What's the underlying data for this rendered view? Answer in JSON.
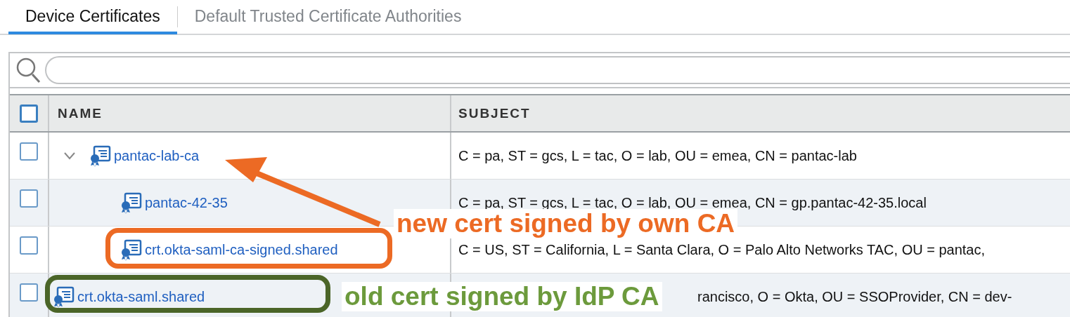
{
  "tabs": [
    {
      "label": "Device Certificates",
      "selected": true
    },
    {
      "label": "Default Trusted Certificate Authorities",
      "selected": false
    }
  ],
  "table": {
    "header_checkbox": {
      "checked": false
    },
    "columns": [
      "NAME",
      "SUBJECT"
    ],
    "rows": [
      {
        "name": "pantac-lab-ca",
        "subject": "C = pa, ST = gcs, L = tac, O = lab, OU = emea, CN = pantac-lab",
        "checked": false,
        "expanded": true,
        "children": [
          {
            "name": "pantac-42-35",
            "subject": "C = pa, ST = gcs, L = tac, O = lab, OU = emea, CN = gp.pantac-42-35.local",
            "checked": false
          },
          {
            "name": "crt.okta-saml-ca-signed.shared",
            "subject": "C = US, ST = California, L = Santa Clara, O = Palo Alto Networks TAC, OU = pantac,",
            "checked": false
          }
        ]
      },
      {
        "name": "crt.okta-saml.shared",
        "subject": "rancisco, O = Okta, OU = SSOProvider, CN = dev-",
        "checked": false,
        "covered": true
      }
    ]
  },
  "annotations": [
    {
      "kind": "arrow",
      "color": "#ec6a24"
    },
    {
      "kind": "label",
      "text": "new cert signed by own CA",
      "color": "#ec6a24"
    },
    {
      "kind": "outline",
      "color": "#ec6a24"
    },
    {
      "kind": "outline",
      "color": "#4b6528"
    },
    {
      "kind": "label",
      "text": "old cert signed by IdP CA",
      "color": "#6c9a3c"
    }
  ]
}
